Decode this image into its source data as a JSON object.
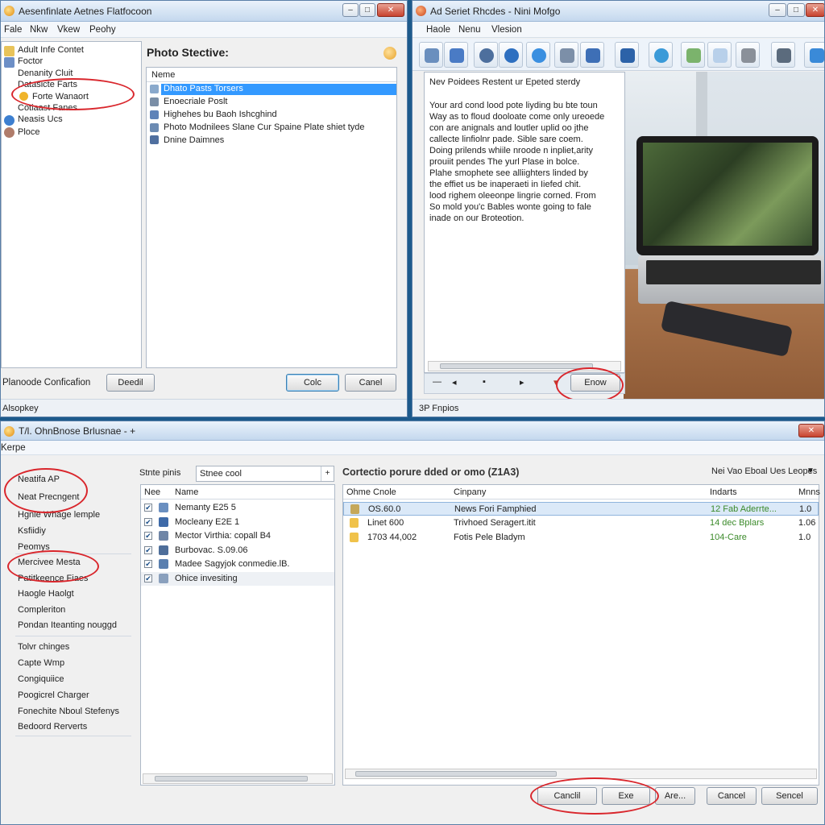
{
  "win1": {
    "title": "Aesenfinlate Aetnes Flatfocoon",
    "menu": [
      "Fale",
      "Nkw",
      "Vkew",
      "Peohy"
    ],
    "tree": [
      "Adult Infe Contet",
      "Foctor",
      "Denanity Cluit",
      "Datasicte Farts",
      "Forte Wanaort",
      "Cotiaast Fanes",
      "Neasis Ucs",
      "Ploce"
    ],
    "panel_title": "Photo Stective:",
    "list_header": "Neme",
    "list_items": [
      "Dhato Pasts Torsers",
      "Enoecriale Poslt",
      "Highehes bu Baoh Ishcghind",
      "Photo Modnilees Slane Cur Spaine Plate shiet tyde",
      "Dnine Daimnes"
    ],
    "footer_label": "Planoode Conficafion",
    "btn_detail": "Deedil",
    "btn_colc": "Colc",
    "btn_cancel": "Canel",
    "status": "Alsopkey"
  },
  "win2": {
    "title": "Ad Seriet Rhcdes - Nini Mofgo",
    "menu": [
      "Haole",
      "Nenu",
      "Vlesion"
    ],
    "doc_heading": "Nev Poidees Restent ur Epeted sterdy",
    "doc_body": [
      "Your ard cond lood pote liyding bu bte toun",
      "Way as to floud dooloate come only ureoede",
      "con are anignals and loutler uplid oo jthe",
      "callecte linfiolnr pade. Sible sare coem.",
      "Doing prilends whiile nroode n inpliet,arity",
      "prouiit pendes The yurl Plase in bolce.",
      "Plahe smophete see alliighters linded by",
      "the effiet us be inaperaeti in Iiefed chit.",
      "lood righem oleeonpe lingrie corned. From",
      "So mold you'c Bables wonte going to fale",
      "inade on our Broteotion."
    ],
    "btn_enow": "Enow",
    "status": "3P Fnpios"
  },
  "win3": {
    "title": "T/l. OhnBnose Brlusnae - +",
    "menu": [
      "Kerpe"
    ],
    "nav_top": [
      "Neatifa AP",
      "Neat Precngent",
      "Hgnie Whage lemple",
      "Ksfiidiy",
      "Peomys",
      "Mercivee Mesta",
      "Patitkeence Fiaes",
      "Haogle Haolgt",
      "Compleriton",
      "Pondan Iteanting nouggd"
    ],
    "nav_bottom": [
      "Tolvr chinges",
      "Capte Wmp",
      "Congiquiice",
      "Poogicrel Charger",
      "Fonechite Nboul Stefenys",
      "Bedoord Rerverts"
    ],
    "search_label": "Stnte pinis",
    "search_value": "Stnee cool",
    "left_cols": [
      "Nee",
      "Name"
    ],
    "left_rows": [
      "Nemanty E25 5",
      "Mocleany E2E 1",
      "Mector Virthia: copall B4",
      "Burbovac. S.09.06",
      "Madee Sagyjok conmedie.lB.",
      "Ohice invesiting"
    ],
    "main_title": "Cortectio porure dded or omo (Z1A3)",
    "filter": "Nei Vao Eboal Ues Leopes",
    "cols": [
      "Ohme Cnole",
      "Cinpany",
      "Indarts",
      "Mnns"
    ],
    "rows": [
      {
        "code": "OS.60.0",
        "company": "News Fori Famphied",
        "ind": "12 Fab Aderrte...",
        "val": "1.0"
      },
      {
        "code": "Linet 600",
        "company": "Trivhoed Seragert.itit",
        "ind": "14 dec Bplars",
        "val": "1.06"
      },
      {
        "code": "1703 44,002",
        "company": "Fotis Pele Bladym",
        "ind": "104-Care",
        "val": "1.0"
      }
    ],
    "buttons": [
      "Canclil",
      "Exe",
      "Are...",
      "Cancel",
      "Sencel"
    ]
  },
  "colors": {
    "accent": "#3399ff",
    "circle": "#d9262c",
    "green_text": "#3b8a2a"
  },
  "icons": [
    "folder-icon",
    "globe-icon",
    "monitor-icon",
    "gear-icon",
    "tools-icon"
  ]
}
